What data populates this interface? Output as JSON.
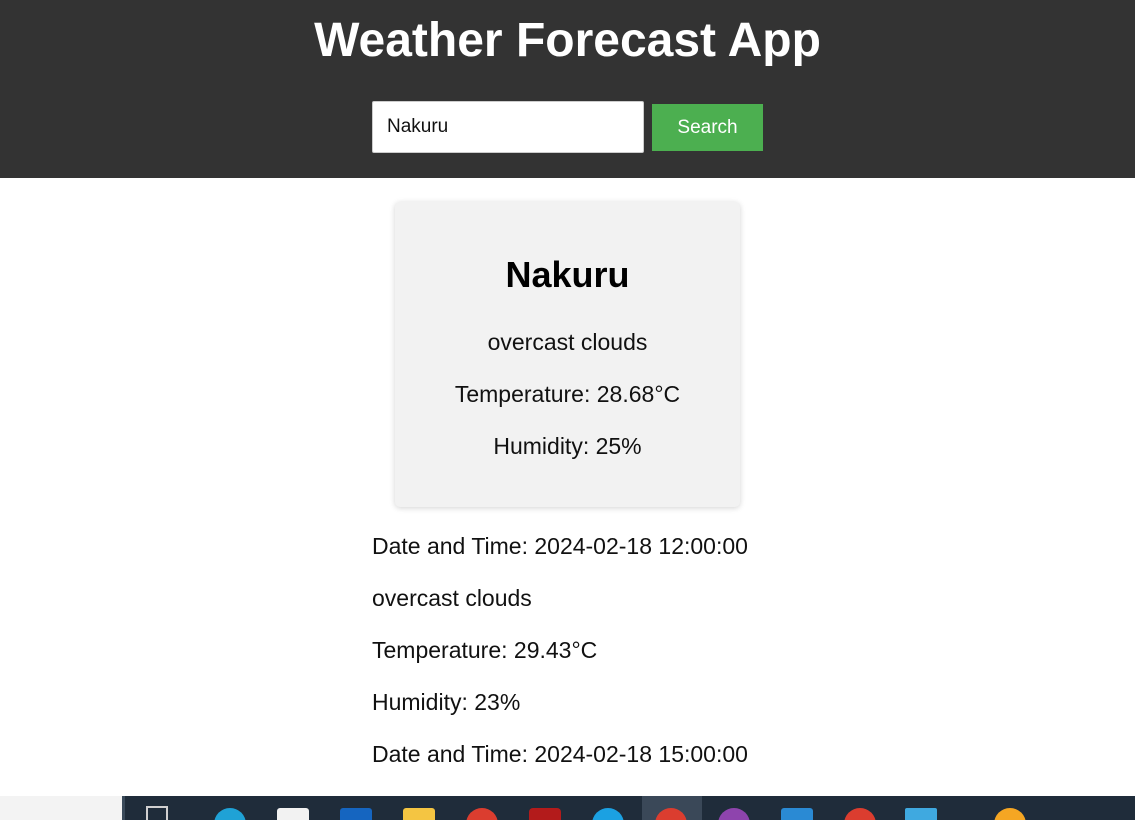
{
  "header": {
    "title": "Weather Forecast App"
  },
  "search": {
    "value": "Nakuru",
    "button_label": "Search"
  },
  "current": {
    "city": "Nakuru",
    "description": "overcast clouds",
    "temperature": "Temperature: 28.68°C",
    "humidity": "Humidity: 25%"
  },
  "forecast": [
    {
      "datetime": "Date and Time: 2024-02-18 12:00:00",
      "description": "overcast clouds",
      "temperature": "Temperature: 29.43°C",
      "humidity": "Humidity: 23%"
    },
    {
      "datetime": "Date and Time: 2024-02-18 15:00:00"
    }
  ],
  "colors": {
    "header_bg": "#333333",
    "button_bg": "#4caf50",
    "card_bg": "#f2f2f2"
  },
  "taskbar": {
    "icons": [
      "task-view-icon",
      "edge-icon",
      "store-icon",
      "mail-icon",
      "file-explorer-icon",
      "chrome-icon",
      "app-red-icon",
      "app-blue-icon",
      "chrome-active-icon",
      "app-purple-icon",
      "vscode-icon",
      "chrome-icon-2",
      "app-cyan-icon",
      "app-orange-icon"
    ]
  }
}
